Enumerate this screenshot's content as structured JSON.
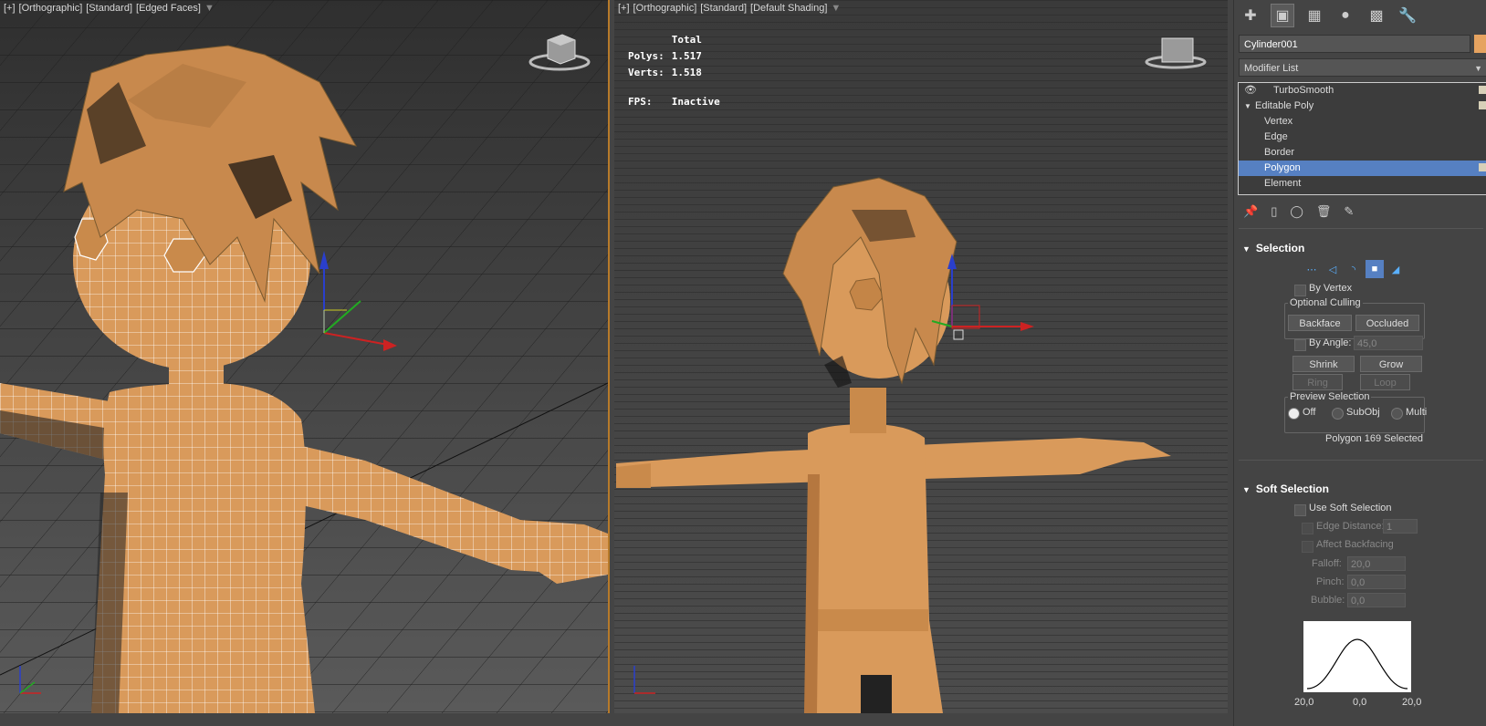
{
  "viewport_left": {
    "label_parts": [
      "[+]",
      "[Orthographic]",
      "[Standard]",
      "[Edged Faces]"
    ]
  },
  "viewport_right": {
    "label_parts": [
      "[+]",
      "[Orthographic]",
      "[Standard]",
      "[Default Shading]"
    ],
    "stats": {
      "header": "Total",
      "polys_label": "Polys:",
      "polys_value": "1.517",
      "verts_label": "Verts:",
      "verts_value": "1.518",
      "fps_label": "FPS:",
      "fps_value": "Inactive"
    }
  },
  "command_panel": {
    "tabs": [
      "create-icon",
      "modify-icon",
      "hierarchy-icon",
      "motion-icon",
      "display-icon",
      "utilities-icon"
    ],
    "object_name": "Cylinder001",
    "object_color": "#e6a360",
    "modifier_list_label": "Modifier List",
    "stack": {
      "turbosmooth": "TurboSmooth",
      "editable_poly": "Editable Poly",
      "vertex": "Vertex",
      "edge": "Edge",
      "border": "Border",
      "polygon": "Polygon",
      "element": "Element"
    },
    "selection": {
      "title": "Selection",
      "by_vertex": "By Vertex",
      "optional_culling": "Optional Culling",
      "backface": "Backface",
      "occluded": "Occluded",
      "by_angle": "By Angle:",
      "by_angle_value": "45,0",
      "shrink": "Shrink",
      "grow": "Grow",
      "ring": "Ring",
      "loop": "Loop",
      "preview_selection": "Preview Selection",
      "off": "Off",
      "subobj": "SubObj",
      "multi": "Multi",
      "status": "Polygon 169 Selected"
    },
    "soft_selection": {
      "title": "Soft Selection",
      "use_soft_selection": "Use Soft Selection",
      "edge_distance": "Edge Distance:",
      "edge_distance_value": "1",
      "affect_backfacing": "Affect Backfacing",
      "falloff": "Falloff:",
      "falloff_value": "20,0",
      "pinch": "Pinch:",
      "pinch_value": "0,0",
      "bubble": "Bubble:",
      "bubble_value": "0,0",
      "curve_left": "20,0",
      "curve_mid": "0,0",
      "curve_right": "20,0"
    }
  },
  "colors": {
    "selection_blue": "#5680c2",
    "model_orange": "#d99a5b",
    "viewport_border_active": "#b77a2a"
  }
}
